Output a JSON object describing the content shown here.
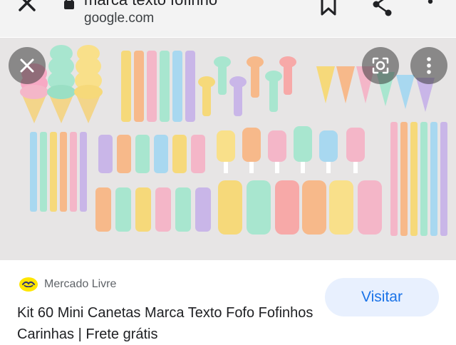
{
  "browser": {
    "page_title": "marca texto fofinho",
    "domain": "google.com",
    "icons": [
      "close-icon",
      "lock-icon",
      "bookmark-icon",
      "share-icon",
      "more-vert-icon"
    ]
  },
  "image_viewer": {
    "overlay_icons": [
      "close-icon",
      "lens-icon",
      "more-vert-icon"
    ],
    "image_subject": "pastel mini highlighters",
    "accent_colors": [
      "#f6d97a",
      "#f7b98a",
      "#f4b6c8",
      "#a8e6cf",
      "#a8d8f0",
      "#c9b6e8",
      "#f7a9a8"
    ]
  },
  "result": {
    "source_name": "Mercado Livre",
    "source_logo": "mercado-livre-logo",
    "title": "Kit 60 Mini Canetas Marca Texto Fofo Fofinhos Carinhas | Frete grátis",
    "visit_label": "Visitar"
  },
  "colors": {
    "accent": "#1a73e8",
    "button_bg": "#e8f0fe",
    "title_text": "#202124",
    "secondary_text": "#5f6368"
  }
}
